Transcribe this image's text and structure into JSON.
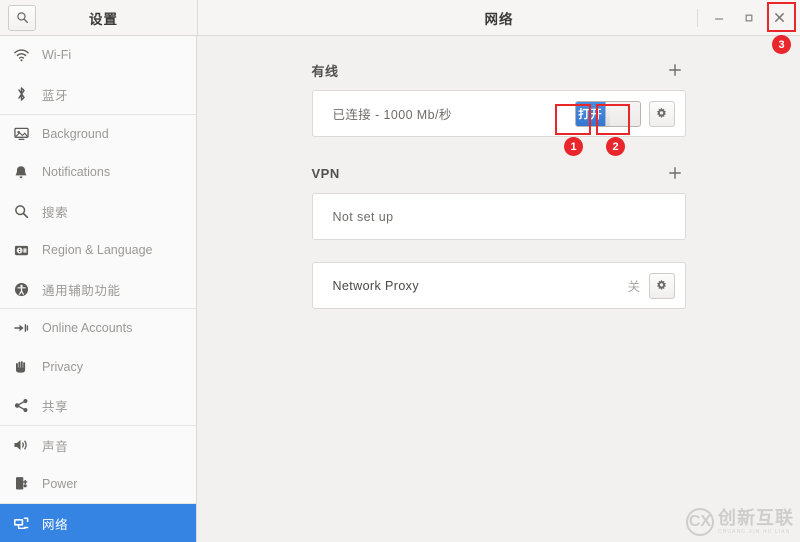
{
  "window": {
    "left_title": "设置",
    "title": "网络",
    "minimize_label": "–",
    "maximize_label": "□",
    "close_label": "✕"
  },
  "search": {
    "icon": "search-icon"
  },
  "sidebar": {
    "items": [
      {
        "label": "Wi-Fi",
        "icon": "wifi-icon",
        "selected": false,
        "separator_above": false,
        "cjk": false
      },
      {
        "label": "蓝牙",
        "icon": "bluetooth-icon",
        "selected": false,
        "separator_above": false,
        "cjk": true
      },
      {
        "label": "Background",
        "icon": "background-icon",
        "selected": false,
        "separator_above": true,
        "cjk": false
      },
      {
        "label": "Notifications",
        "icon": "bell-icon",
        "selected": false,
        "separator_above": false,
        "cjk": false
      },
      {
        "label": "搜索",
        "icon": "search-icon",
        "selected": false,
        "separator_above": false,
        "cjk": true
      },
      {
        "label": "Region & Language",
        "icon": "region-language-icon",
        "selected": false,
        "separator_above": false,
        "cjk": false
      },
      {
        "label": "通用辅助功能",
        "icon": "accessibility-icon",
        "selected": false,
        "separator_above": false,
        "cjk": true
      },
      {
        "label": "Online Accounts",
        "icon": "online-accounts-icon",
        "selected": false,
        "separator_above": true,
        "cjk": false
      },
      {
        "label": "Privacy",
        "icon": "privacy-hand-icon",
        "selected": false,
        "separator_above": false,
        "cjk": false
      },
      {
        "label": "共享",
        "icon": "sharing-icon",
        "selected": false,
        "separator_above": false,
        "cjk": true
      },
      {
        "label": "声音",
        "icon": "sound-icon",
        "selected": false,
        "separator_above": true,
        "cjk": true
      },
      {
        "label": "Power",
        "icon": "power-icon",
        "selected": false,
        "separator_above": false,
        "cjk": false
      },
      {
        "label": "网络",
        "icon": "network-icon",
        "selected": true,
        "separator_above": true,
        "cjk": true
      }
    ]
  },
  "main": {
    "wired": {
      "title": "有线",
      "add_label": "+",
      "connection_status": "已连接 - 1000 Mb/秒",
      "toggle_on_label": "打开",
      "settings_icon": "gear-icon"
    },
    "vpn": {
      "title": "VPN",
      "add_label": "+",
      "status": "Not set up"
    },
    "proxy": {
      "label": "Network Proxy",
      "state": "关",
      "settings_icon": "gear-icon"
    }
  },
  "annotations": {
    "markers": [
      {
        "number": "1",
        "target": "wired-toggle-on"
      },
      {
        "number": "2",
        "target": "wired-toggle-off"
      },
      {
        "number": "3",
        "target": "window-close-button"
      }
    ]
  },
  "watermark": {
    "logo_text": "CX",
    "main_text": "创新互联",
    "sub_text": "CHUANG XIN HU LIAN"
  },
  "colors": {
    "accent": "#3584e4",
    "toggle_on": "#3576cf",
    "annotation": "#e8262b",
    "sidebar_bg": "#fbfafa",
    "main_bg": "#f2f1f0"
  }
}
